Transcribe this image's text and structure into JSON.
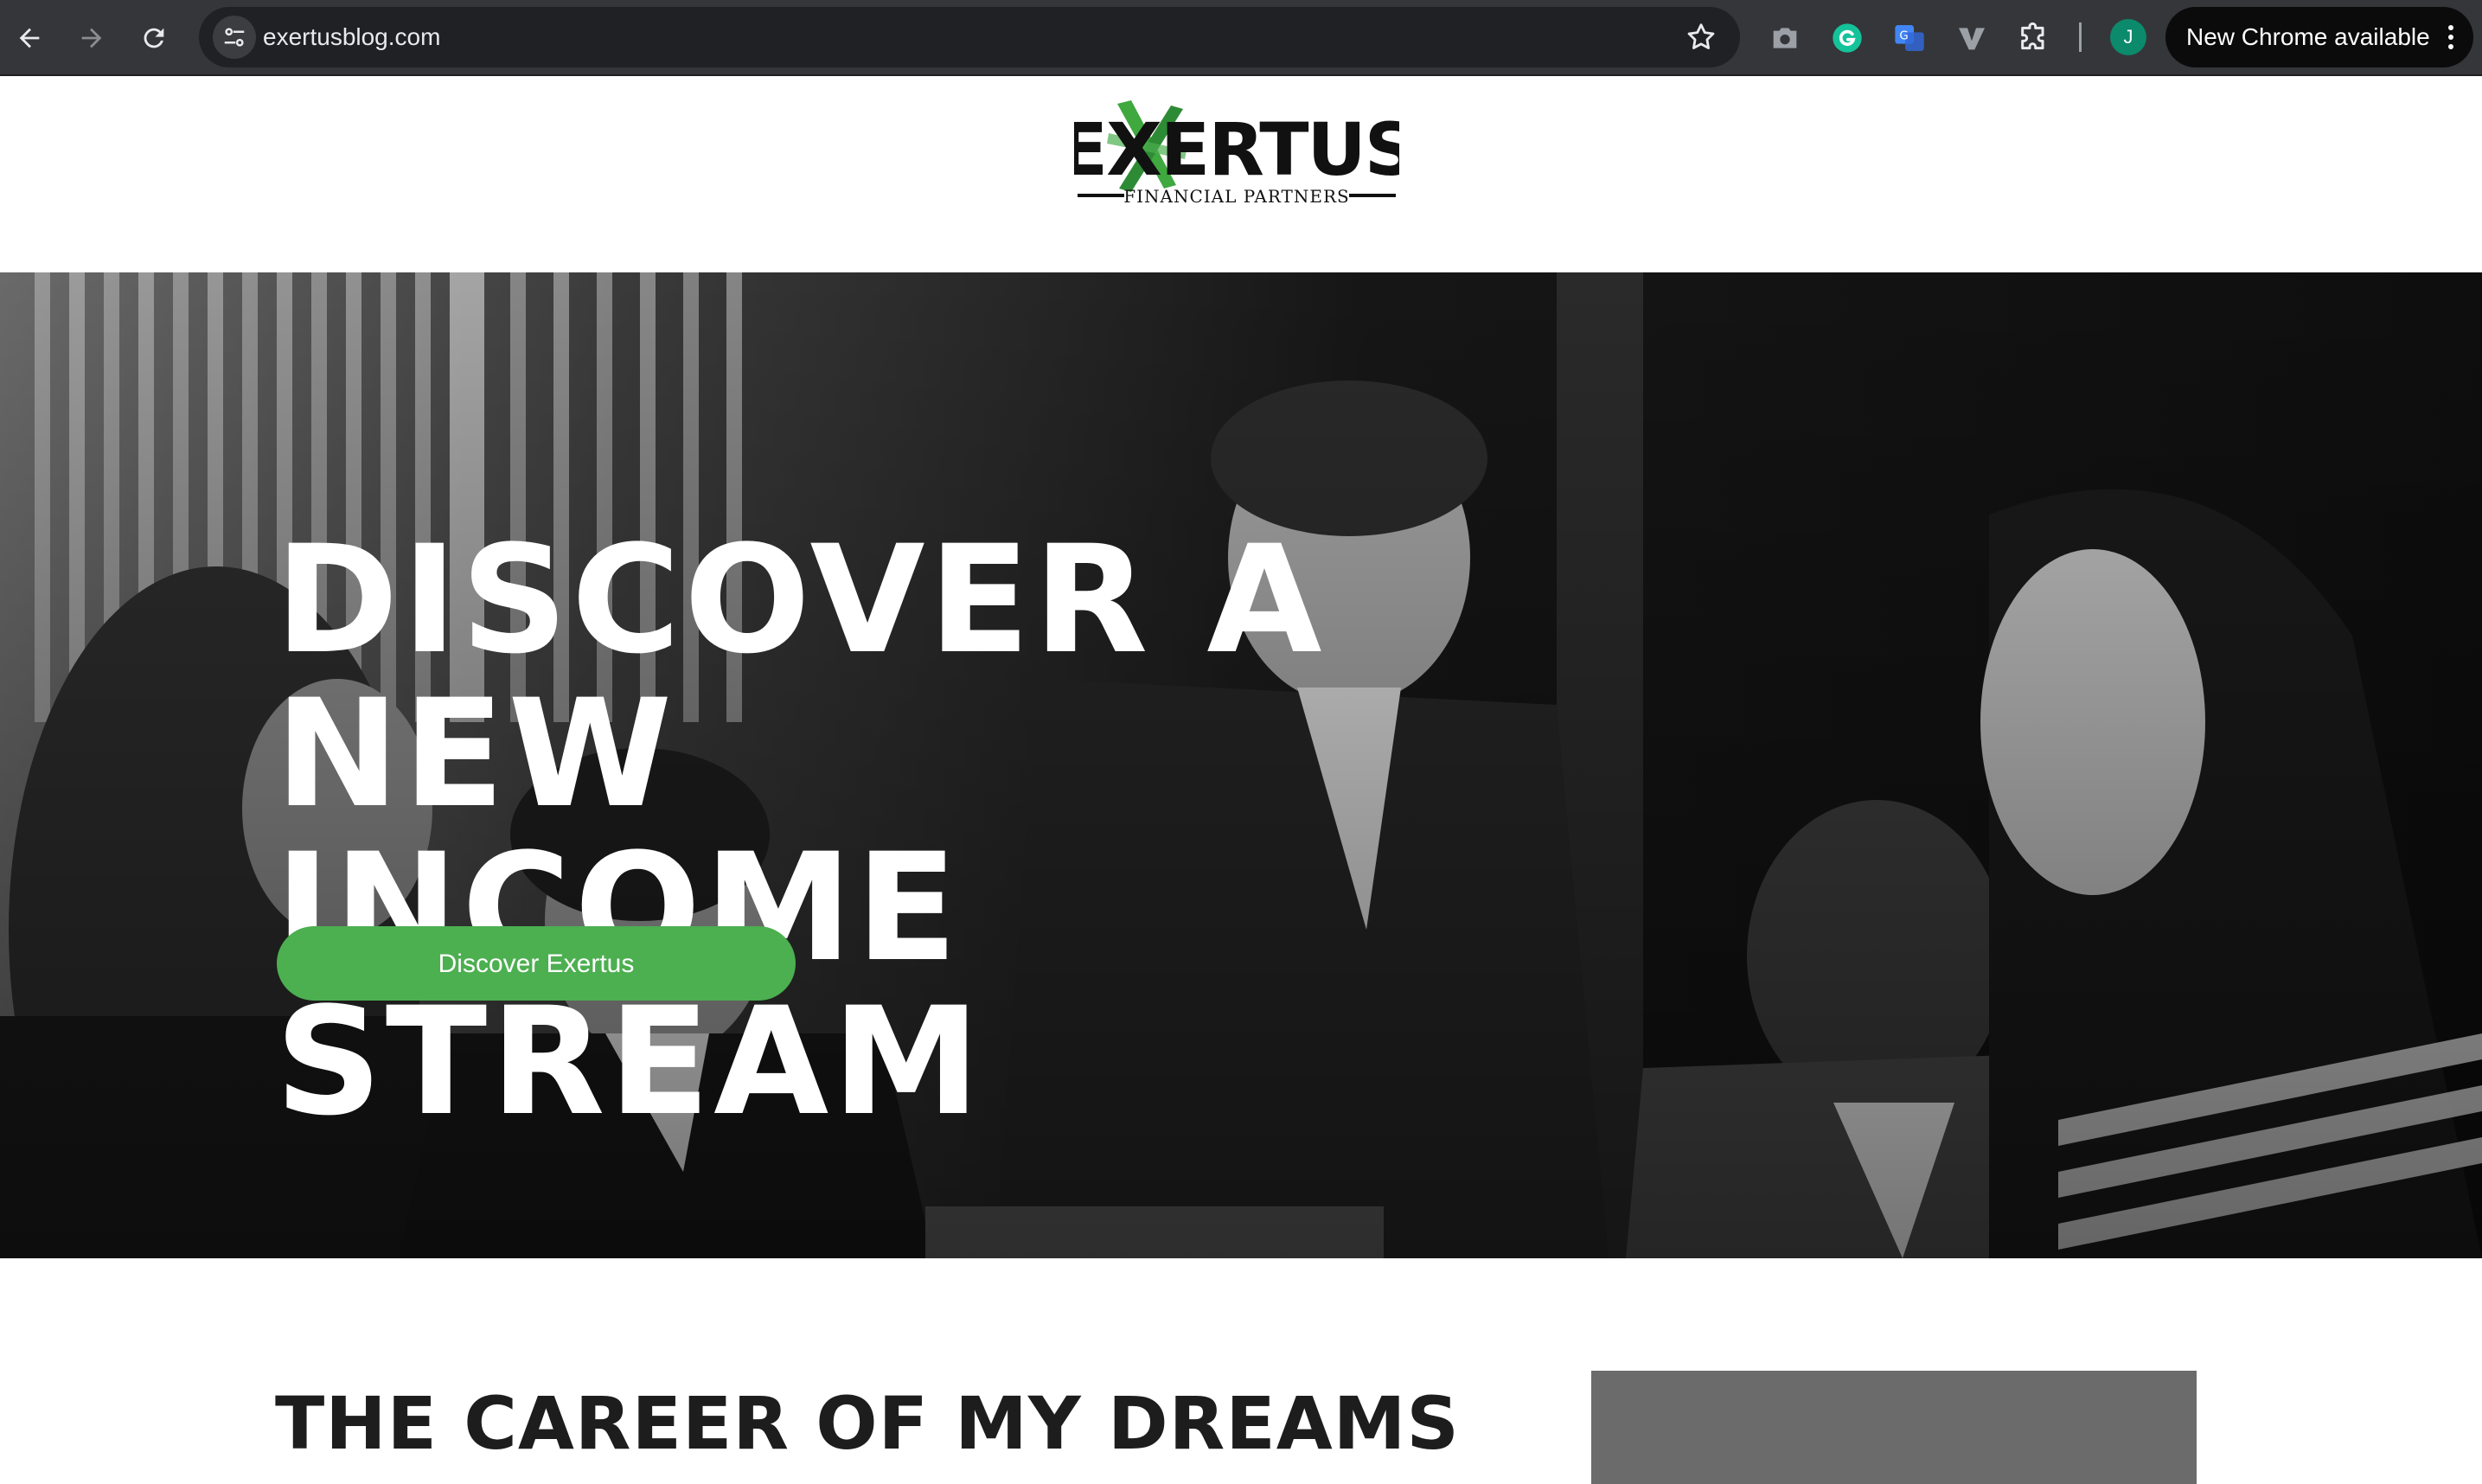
{
  "browser": {
    "url": "exertusblog.com",
    "update_label": "New Chrome available",
    "profile_initial": "J",
    "profile_color": "#0b8a6c"
  },
  "site": {
    "logo_text": "EXERTUS",
    "logo_tagline": "Financial Partners",
    "brand_green": "#4caf50"
  },
  "hero": {
    "title_line1": "DISCOVER A NEW",
    "title_line2": "INCOME STREAM",
    "cta_label": "Discover Exertus"
  },
  "section": {
    "title": "THE CAREER OF MY DREAMS"
  },
  "icons": {
    "back": "arrow-left-icon",
    "forward": "arrow-right-icon",
    "reload": "reload-icon",
    "site_info": "tune-icon",
    "bookmark": "star-icon",
    "extensions": [
      "camera-icon",
      "grammarly-icon",
      "translate-icon",
      "vimeo-icon",
      "puzzle-icon"
    ],
    "menu": "kebab-menu-icon"
  }
}
